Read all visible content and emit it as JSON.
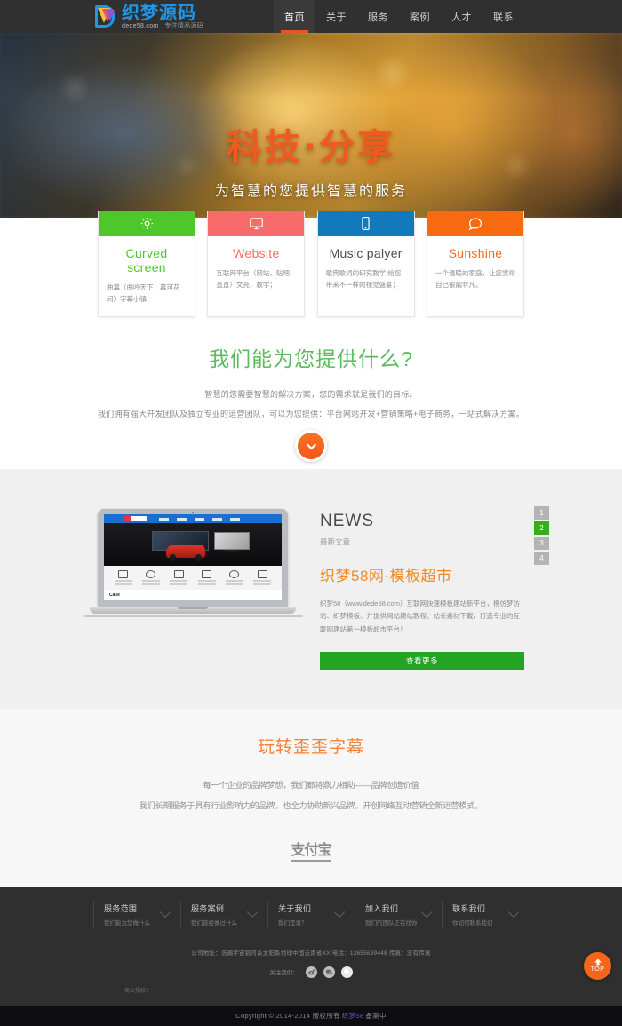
{
  "header": {
    "logo": {
      "cn": "织梦源码",
      "domain": "dede58.com",
      "tagline": "专注精品源码"
    },
    "nav": [
      {
        "label": "首页",
        "active": true
      },
      {
        "label": "关于",
        "active": false
      },
      {
        "label": "服务",
        "active": false
      },
      {
        "label": "案例",
        "active": false
      },
      {
        "label": "人才",
        "active": false
      },
      {
        "label": "联系",
        "active": false
      }
    ]
  },
  "hero": {
    "title": "科技·分享",
    "subtitle": "为智慧的您提供智慧的服务",
    "title_color": "#f05a1e"
  },
  "cards": [
    {
      "icon": "gear-icon",
      "color": "#4ec72a",
      "title": "Curved screen",
      "desc": "曲幕（曲吟天下，幕可花间）字幕小镇"
    },
    {
      "icon": "monitor-icon",
      "color": "#f76b6b",
      "title": "Website",
      "desc": "互联网平台（网站、贴吧、直直）文亮，教学；"
    },
    {
      "icon": "phone-icon",
      "color": "#1379bd",
      "title": "Music palyer",
      "desc": "歌典歌词的研究教学,给您带来不一样的视觉盛宴；"
    },
    {
      "icon": "chat-icon",
      "color": "#f86a10",
      "title": "Sunshine",
      "desc": "一个温暖的家庭，让您觉得自己很靓非凡。"
    }
  ],
  "services": {
    "title": "我们能为您提供什么?",
    "line1": "智慧的您需要智慧的解决方案，您的需求就是我们的目标。",
    "line2": "我们拥有强大开发团队及独立专业的运营团队，可以为您提供：平台网站开发+营销策略+电子商务，一站式解决方案。",
    "scroll_icon": "chevron-down-icon"
  },
  "news": {
    "heading": "NEWS",
    "subheading": "最新文章",
    "title": "织梦58网-模板超市",
    "paragraph": "织梦58（www.dede58.com）互联网快速模板建站新平台，模仿梦仿站、织梦模板、并提供网站建站教程、站长素材下载，打造专业的互联网建站第一模板超市平台！",
    "button": "查看更多",
    "pagination": [
      {
        "label": "1",
        "active": false
      },
      {
        "label": "2",
        "active": true
      },
      {
        "label": "3",
        "active": false
      },
      {
        "label": "4",
        "active": false
      }
    ],
    "accent_color": "#f08a1e",
    "button_color": "#23a423"
  },
  "about": {
    "title": "玩转歪歪字幕",
    "line1": "每一个企业的品牌梦想，我们都将鼎力相助——品牌创造价值",
    "line2": "我们长期服务于具有行业影响力的品牌，也全力协助新兴品牌。开创网络互动营销全新运营模式。",
    "logo_text": "支付宝"
  },
  "footer": {
    "columns": [
      {
        "title": "服务范围",
        "sub": "我们能为您做什么"
      },
      {
        "title": "服务案例",
        "sub": "我们曾经做过什么"
      },
      {
        "title": "关于我们",
        "sub": "我们是谁？"
      },
      {
        "title": "加入我们",
        "sub": "我们的团队正在找你"
      },
      {
        "title": "联系我们",
        "sub": "你如何联系我们"
      }
    ],
    "address": "公司地址：浩瀚宇宙银河系太阳系地球中国云南省XX 电话：13655699448 传真：没有传真",
    "social_label": "关注我们：",
    "social": [
      "weibo-icon",
      "wechat-icon",
      "qq-icon"
    ],
    "beian_label": "商业授权：",
    "copyright_prefix": "Copyright © 2014-2014 版权所有",
    "copyright_brand": "织梦58",
    "copyright_suffix": "备案中",
    "back_to_top": "TOP"
  }
}
